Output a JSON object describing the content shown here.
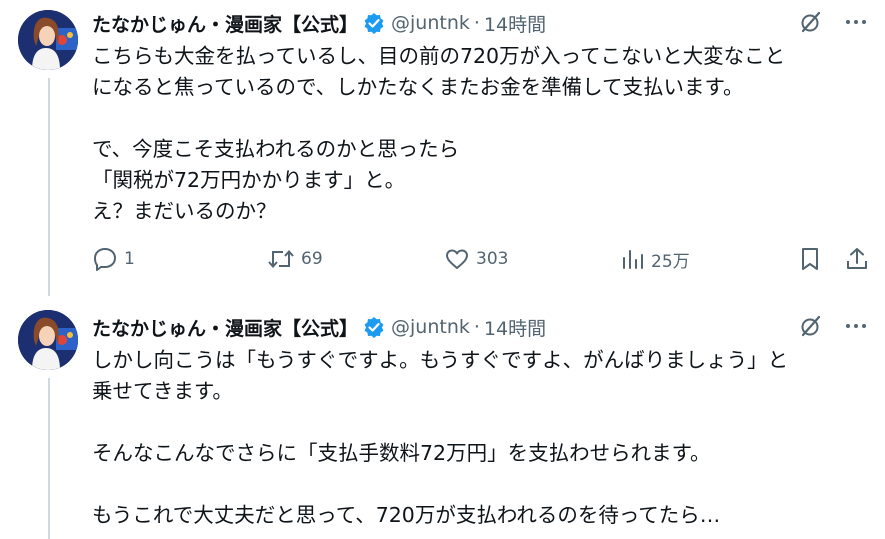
{
  "tweets": [
    {
      "author": {
        "name": "たなかじゅん・漫画家【公式】",
        "handle": "@juntnk",
        "separator": "·",
        "time": "14時間"
      },
      "lines": [
        "こちらも大金を払っているし、目の前の720万が入ってこないと大変なこと",
        "になると焦っているので、しかたなくまたお金を準備して支払います。",
        "",
        "で、今度こそ支払われるのかと思ったら",
        "「関税が72万円かかります」と。",
        "え？まだいるのか？"
      ],
      "actions": {
        "replies": "1",
        "reposts": "69",
        "likes": "303",
        "views": "25万"
      }
    },
    {
      "author": {
        "name": "たなかじゅん・漫画家【公式】",
        "handle": "@juntnk",
        "separator": "·",
        "time": "14時間"
      },
      "lines": [
        "しかし向こうは「もうすぐですよ。もうすぐですよ、がんばりましょう」と",
        "乗せてきます。",
        "",
        "そんなこんなでさらに「支払手数料72万円」を支払わせられます。",
        "",
        "もうこれで大丈夫だと思って、720万が支払われるのを待ってたら…"
      ]
    }
  ],
  "colors": {
    "text": "#0f1419",
    "secondary": "#536471",
    "verified": "#1d9bf0",
    "thread_line": "#cfd9de"
  },
  "icons": [
    "grok-icon",
    "more-icon",
    "verified-badge-icon",
    "reply-icon",
    "repost-icon",
    "like-icon",
    "views-icon",
    "bookmark-icon",
    "share-icon"
  ]
}
